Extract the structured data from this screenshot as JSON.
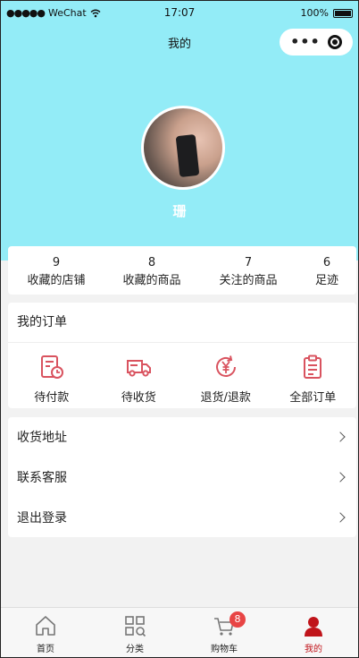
{
  "status_bar": {
    "carrier": "WeChat",
    "time": "17:07",
    "battery": "100%"
  },
  "nav": {
    "title": "我的"
  },
  "profile": {
    "username": "珊"
  },
  "stats": [
    {
      "count": "9",
      "label": "收藏的店铺"
    },
    {
      "count": "8",
      "label": "收藏的商品"
    },
    {
      "count": "7",
      "label": "关注的商品"
    },
    {
      "count": "6",
      "label": "足迹"
    }
  ],
  "orders": {
    "title": "我的订单",
    "items": [
      {
        "label": "待付款",
        "icon": "pending-payment-icon"
      },
      {
        "label": "待收货",
        "icon": "delivery-truck-icon"
      },
      {
        "label": "退货/退款",
        "icon": "refund-yuan-icon"
      },
      {
        "label": "全部订单",
        "icon": "clipboard-icon"
      }
    ]
  },
  "menu": [
    {
      "label": "收货地址"
    },
    {
      "label": "联系客服"
    },
    {
      "label": "退出登录"
    }
  ],
  "tabbar": [
    {
      "label": "首页",
      "icon": "home-icon"
    },
    {
      "label": "分类",
      "icon": "grid-icon"
    },
    {
      "label": "购物车",
      "icon": "cart-icon",
      "badge": "8"
    },
    {
      "label": "我的",
      "icon": "person-icon"
    }
  ],
  "colors": {
    "header": "#93ecf7",
    "accent": "#c0141a",
    "order_icon": "#d9535f",
    "badge": "#e84545"
  }
}
